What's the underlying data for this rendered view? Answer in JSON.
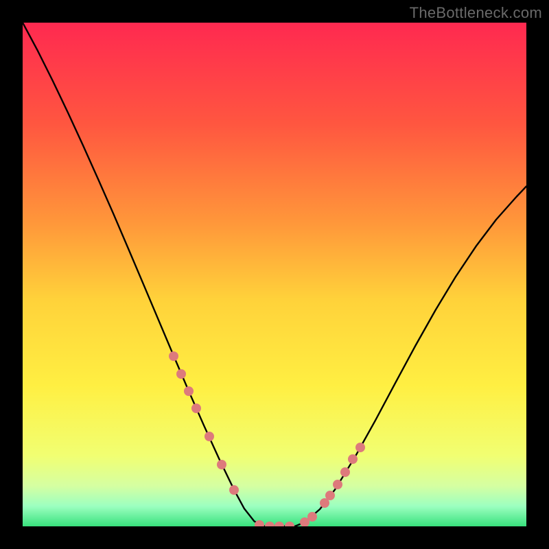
{
  "watermark": "TheBottleneck.com",
  "gradient": {
    "stops": [
      {
        "offset": 0.0,
        "color": "#ff2950"
      },
      {
        "offset": 0.2,
        "color": "#ff5640"
      },
      {
        "offset": 0.4,
        "color": "#ff983a"
      },
      {
        "offset": 0.55,
        "color": "#ffd23a"
      },
      {
        "offset": 0.72,
        "color": "#ffef42"
      },
      {
        "offset": 0.86,
        "color": "#f1ff72"
      },
      {
        "offset": 0.92,
        "color": "#d5ffa2"
      },
      {
        "offset": 0.96,
        "color": "#9cffc0"
      },
      {
        "offset": 1.0,
        "color": "#38e27d"
      }
    ]
  },
  "curve": {
    "stroke": "#000000",
    "width": 2.4
  },
  "dot_color": "#dd7a7c",
  "chart_data": {
    "type": "line",
    "title": "",
    "xlabel": "",
    "ylabel": "",
    "note": "Bottleneck-style V-curve. Axes are in fractional plot units (0–1 on each axis, y=0 at bottom).",
    "xlim": [
      0,
      1
    ],
    "ylim": [
      0,
      1
    ],
    "series": [
      {
        "name": "left-branch",
        "x": [
          0.0,
          0.03,
          0.06,
          0.09,
          0.12,
          0.15,
          0.18,
          0.21,
          0.24,
          0.27,
          0.3,
          0.33,
          0.36,
          0.39,
          0.42,
          0.44,
          0.46,
          0.48
        ],
        "y": [
          1.0,
          0.944,
          0.884,
          0.821,
          0.756,
          0.689,
          0.621,
          0.551,
          0.48,
          0.409,
          0.338,
          0.268,
          0.2,
          0.134,
          0.072,
          0.035,
          0.01,
          0.0
        ]
      },
      {
        "name": "valley",
        "x": [
          0.48,
          0.495,
          0.51,
          0.525,
          0.54
        ],
        "y": [
          0.0,
          0.0,
          0.0,
          0.0,
          0.0
        ]
      },
      {
        "name": "right-branch",
        "x": [
          0.54,
          0.56,
          0.59,
          0.62,
          0.66,
          0.7,
          0.74,
          0.78,
          0.82,
          0.86,
          0.9,
          0.94,
          0.98,
          1.0
        ],
        "y": [
          0.0,
          0.008,
          0.034,
          0.073,
          0.138,
          0.21,
          0.285,
          0.359,
          0.43,
          0.496,
          0.556,
          0.609,
          0.654,
          0.675
        ]
      }
    ],
    "scatter": {
      "name": "markers",
      "color": "#dd7a7c",
      "x": [
        0.3,
        0.315,
        0.33,
        0.345,
        0.37,
        0.395,
        0.42,
        0.47,
        0.49,
        0.51,
        0.53,
        0.56,
        0.575,
        0.6,
        0.61,
        0.625,
        0.64,
        0.655,
        0.67
      ],
      "y": [
        0.338,
        0.302,
        0.268,
        0.234,
        0.178,
        0.123,
        0.072,
        0.003,
        0.0,
        0.0,
        0.0,
        0.008,
        0.019,
        0.047,
        0.061,
        0.083,
        0.108,
        0.133,
        0.157
      ]
    }
  }
}
